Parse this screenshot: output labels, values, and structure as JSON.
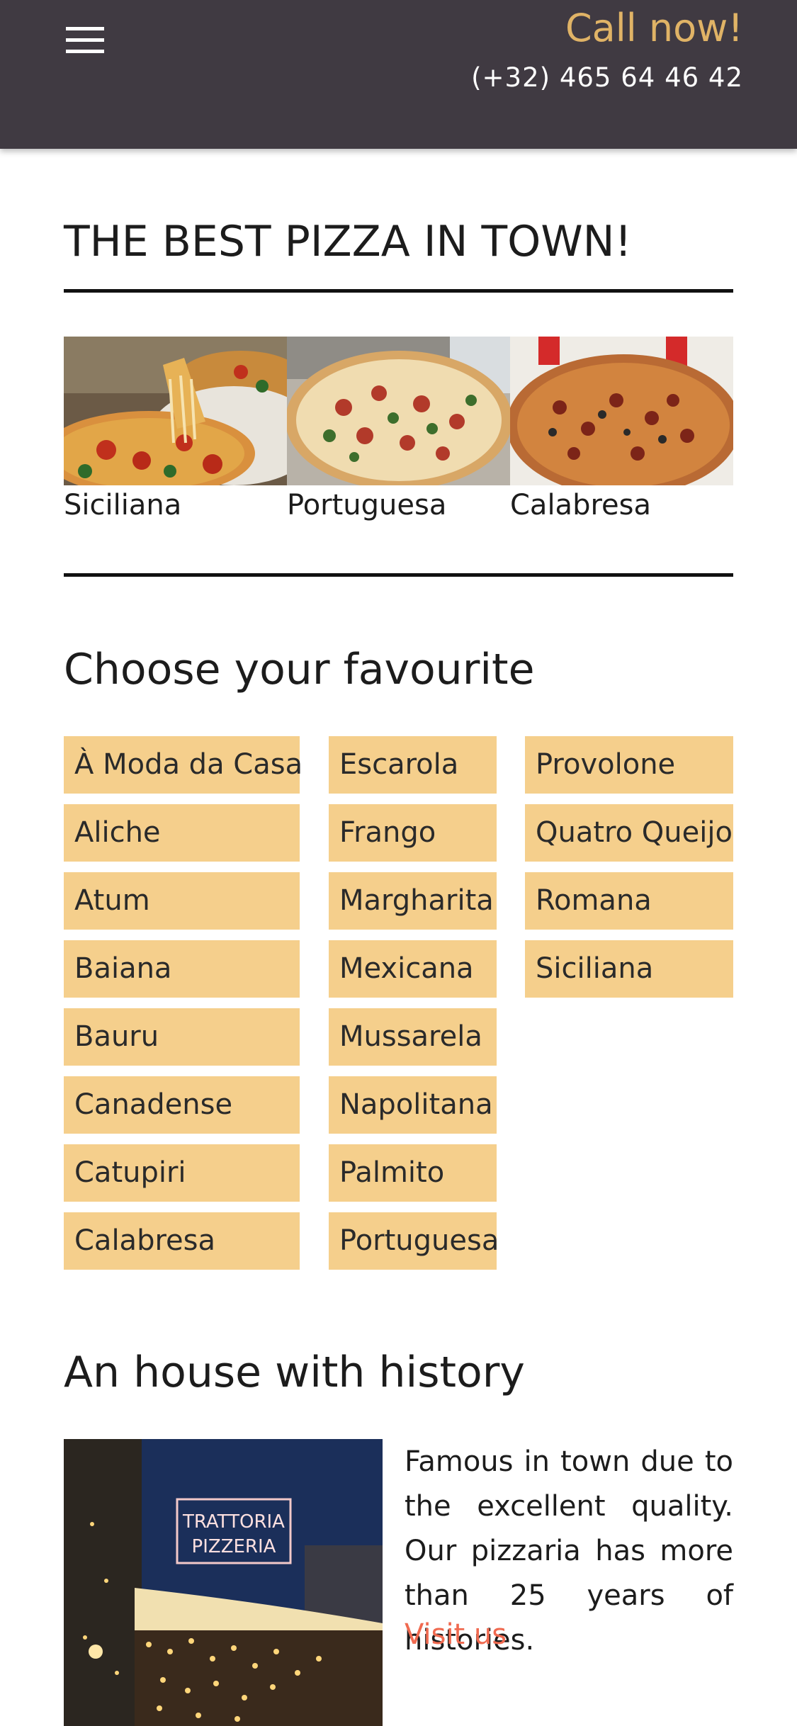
{
  "header": {
    "menu_icon": "hamburger-menu-icon",
    "call_label": "Call now!",
    "phone": "(+32) 465 64 46 42"
  },
  "hero": {
    "title": "THE BEST PIZZA IN TOWN!",
    "pizzas": [
      {
        "name": "Siciliana"
      },
      {
        "name": "Portuguesa"
      },
      {
        "name": "Calabresa"
      }
    ]
  },
  "favourites": {
    "title": "Choose your favourite",
    "columns": [
      [
        "À Moda da Casa",
        "Aliche",
        "Atum",
        "Baiana",
        "Bauru",
        "Canadense",
        "Catupiri",
        "Calabresa"
      ],
      [
        "Escarola",
        "Frango",
        "Margharita",
        "Mexicana",
        "Mussarela",
        "Napolitana",
        "Palmito",
        "Portuguesa"
      ],
      [
        "Provolone",
        "Quatro Queijo",
        "Romana",
        "Siciliana"
      ]
    ]
  },
  "history": {
    "title": "An house with history",
    "description": "Famous in town due to the excellent quality. Our pizzaria has more than 25 years of histories.",
    "link": "Visit us",
    "sign_line1": "TRATTORIA",
    "sign_line2": "PIZZERIA"
  },
  "colors": {
    "header_bg": "#403a42",
    "accent_gold": "#e0b366",
    "button_bg": "#f5cf8c",
    "link": "#f06a50"
  }
}
